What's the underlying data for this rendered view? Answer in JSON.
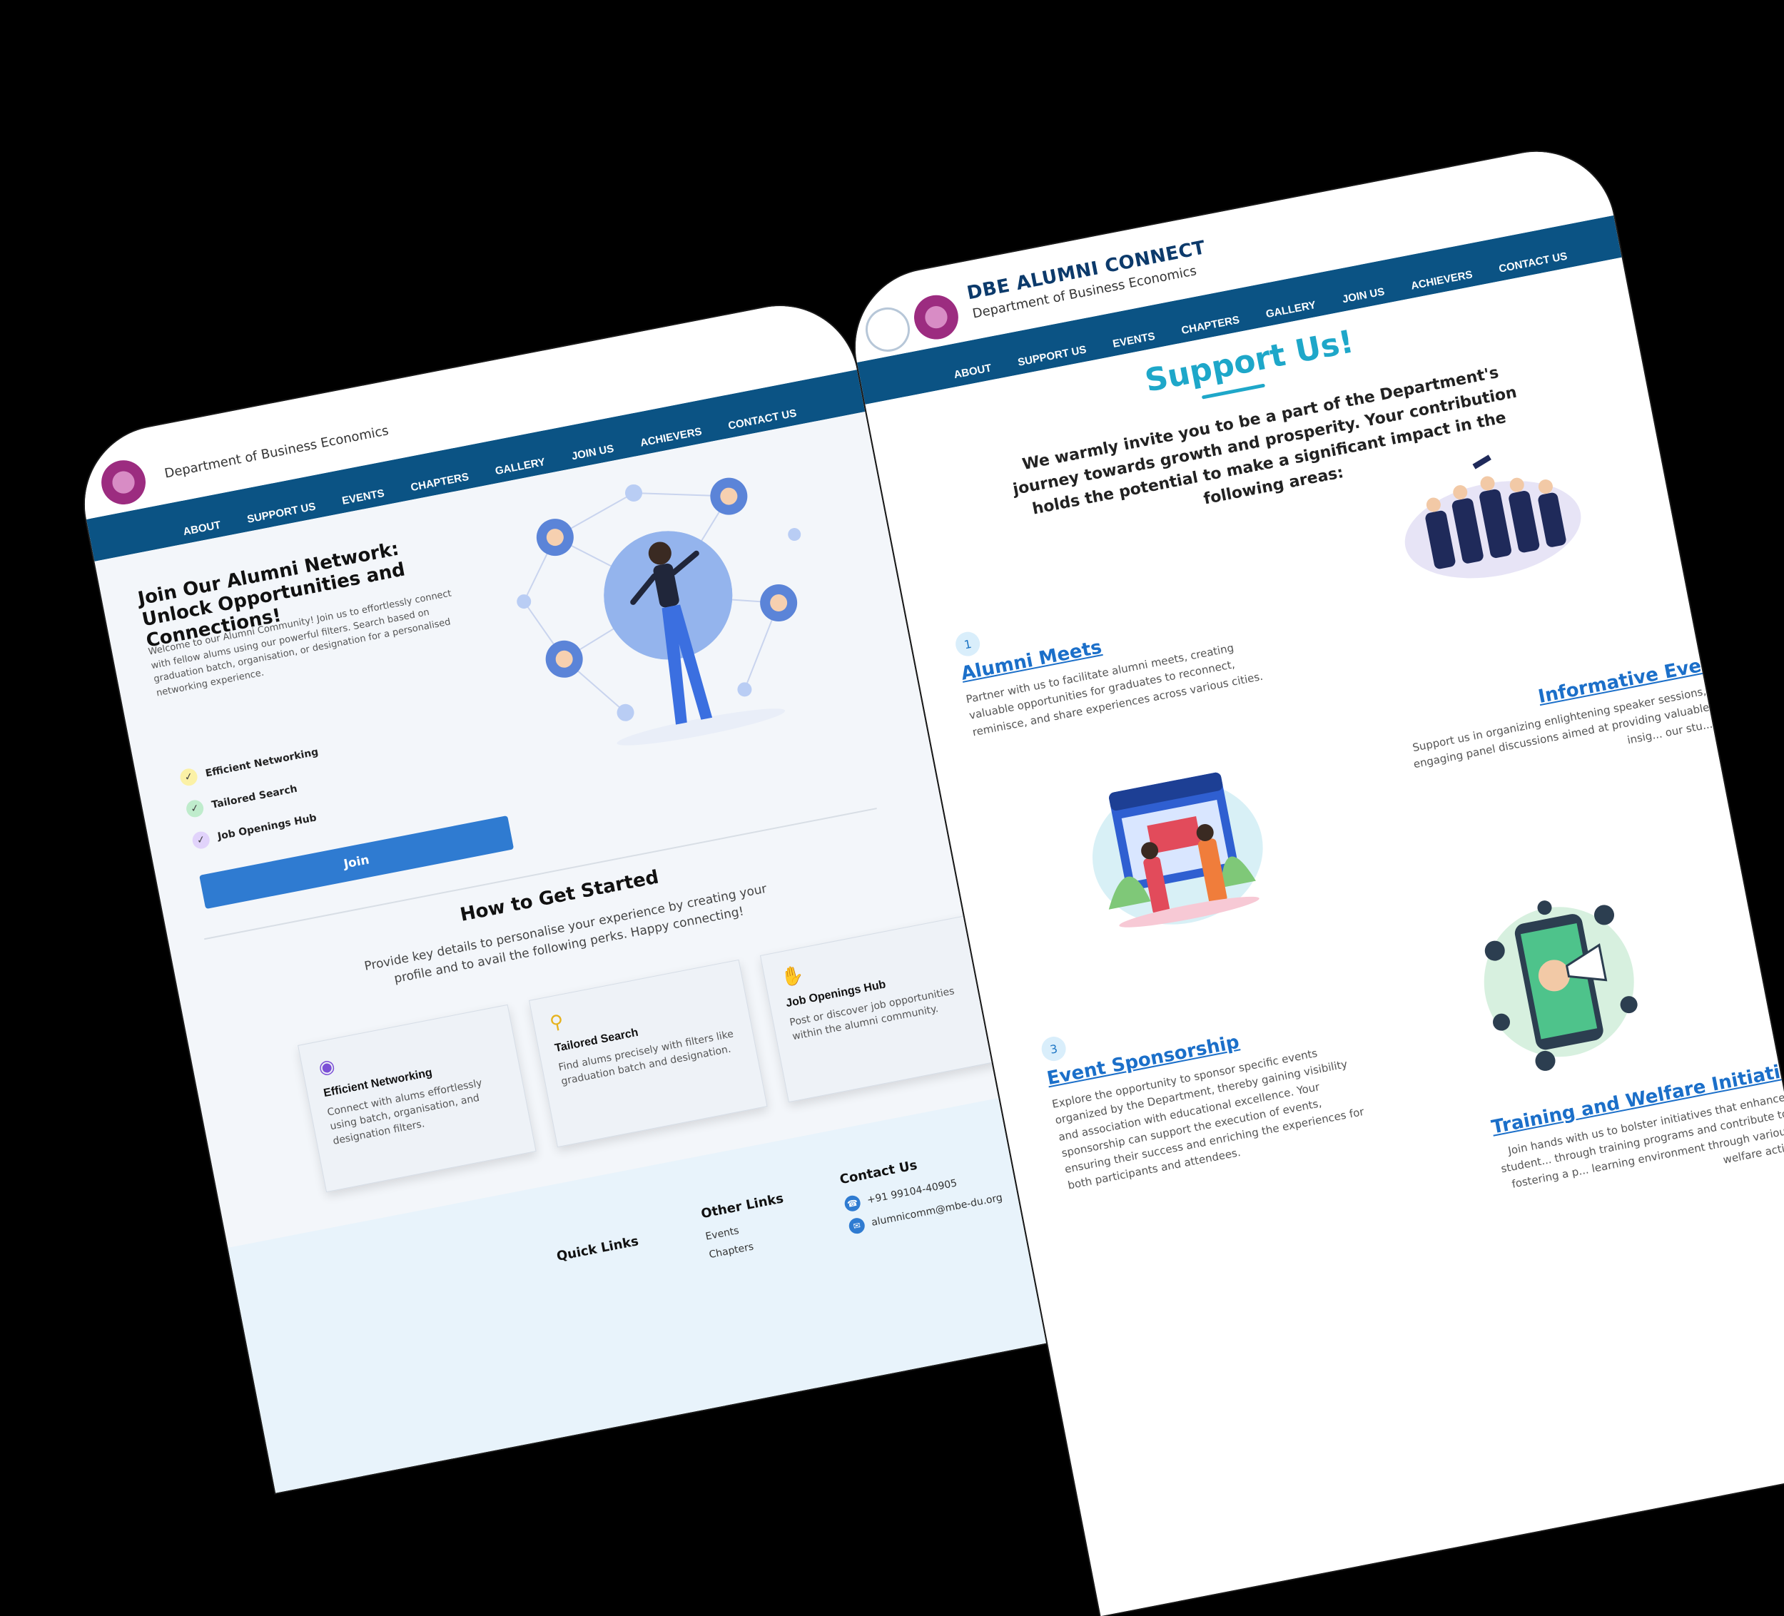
{
  "left_page": {
    "header": {
      "subtitle": "Department of Business Economics"
    },
    "nav": [
      "ABOUT",
      "SUPPORT US",
      "EVENTS",
      "CHAPTERS",
      "GALLERY",
      "JOIN US",
      "ACHIEVERS",
      "CONTACT US"
    ],
    "hero": {
      "title": "Join Our Alumni Network: Unlock Opportunities and Connections!",
      "description": "Welcome to our Alumni Community! Join us to effortlessly connect with fellow alums using our powerful filters. Search based on graduation batch, organisation, or designation for a personalised networking experience.",
      "features": [
        "Efficient Networking",
        "Tailored Search",
        "Job Openings Hub"
      ],
      "join_label": "Join"
    },
    "how_to": {
      "title": "How to Get Started",
      "description": "Provide key details to personalise your experience by creating your profile and to avail the following perks. Happy connecting!",
      "cards": [
        {
          "icon": "globe-icon",
          "title": "Efficient Networking",
          "text": "Connect with alums effortlessly using batch, organisation, and designation filters."
        },
        {
          "icon": "magnifier-icon",
          "title": "Tailored Search",
          "text": "Find alums precisely with filters like graduation batch and designation."
        },
        {
          "icon": "handshake-icon",
          "title": "Job Openings Hub",
          "text": "Post or discover job opportunities within the alumni community."
        }
      ]
    },
    "footer": {
      "quick_links": {
        "heading": "Quick Links"
      },
      "other_links": {
        "heading": "Other Links",
        "items": [
          "Events",
          "Chapters"
        ]
      },
      "contact": {
        "heading": "Contact Us",
        "phone": "+91 99104-40905",
        "email": "alumnicomm@mbe-du.org"
      }
    }
  },
  "right_page": {
    "header": {
      "title": "DBE ALUMNI CONNECT",
      "subtitle": "Department of Business Economics"
    },
    "nav": [
      "ABOUT",
      "SUPPORT US",
      "EVENTS",
      "CHAPTERS",
      "GALLERY",
      "JOIN US",
      "ACHIEVERS",
      "CONTACT US"
    ],
    "title": "Support Us!",
    "intro": "We warmly invite you to be a part of the Department's journey towards growth and prosperity. Your contribution holds the potential to make a significant impact in the following areas:",
    "items": [
      {
        "num": "1",
        "title": "Alumni Meets",
        "text": "Partner with us to facilitate alumni meets, creating valuable opportunities for graduates to reconnect, reminisce, and share experiences across various cities."
      },
      {
        "title": "Informative Eve",
        "text": "Support us in organizing enlightening speaker sessions, engaging panel discussions aimed at providing valuable insig... our stu..."
      },
      {
        "num": "3",
        "title": "Event Sponsorship",
        "text": "Explore the opportunity to sponsor specific events organized by the Department, thereby gaining visibility and association with educational excellence. Your sponsorship can support the execution of events, ensuring their success and enriching the experiences for both participants and attendees."
      },
      {
        "title": "Training and Welfare Initiati",
        "text": "Join hands with us to bolster initiatives that enhance student... through training programs and contribute to fostering a p... learning environment through various welfare acti..."
      }
    ]
  },
  "colors": {
    "nav": "#0b5384",
    "accent": "#1ea7c9",
    "button": "#2f7bd1",
    "link": "#1b6fc9"
  }
}
